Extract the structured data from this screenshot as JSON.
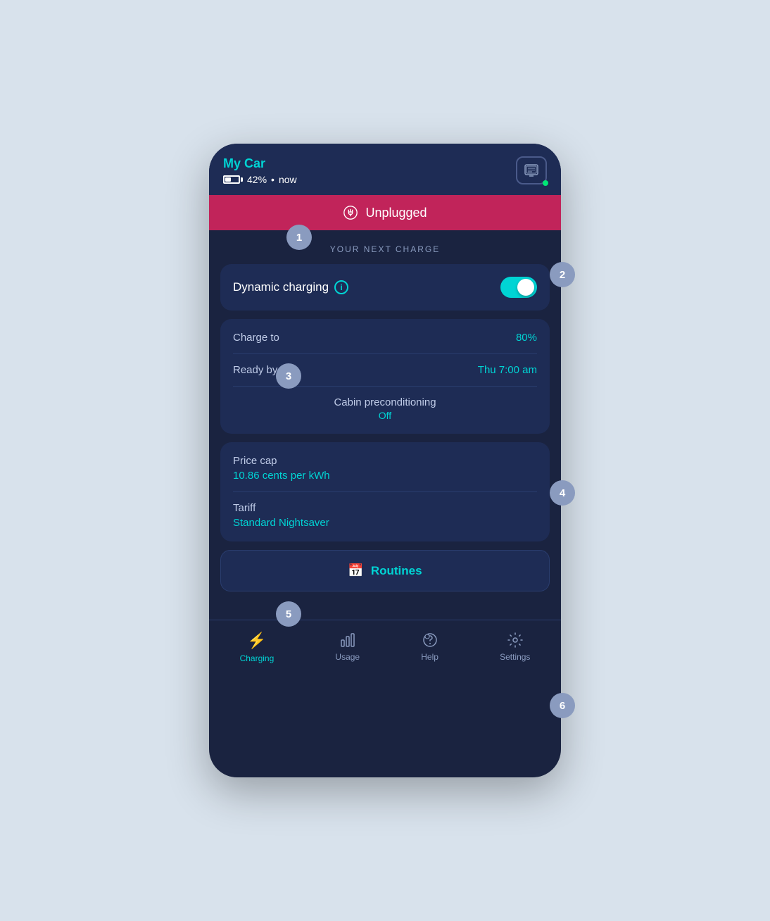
{
  "header": {
    "car_name": "My Car",
    "battery_percent": "42%",
    "battery_time": "now",
    "device_icon": "device-icon"
  },
  "status": {
    "label": "Unplugged",
    "state": "unplugged"
  },
  "next_charge": {
    "section_title": "YOUR NEXT CHARGE",
    "dynamic_charging": {
      "label": "Dynamic charging",
      "info": "i",
      "enabled": true
    },
    "charge_to": {
      "label": "Charge to",
      "value": "80%"
    },
    "ready_by": {
      "label": "Ready by",
      "value": "Thu 7:00 am"
    },
    "cabin_preconditioning": {
      "label": "Cabin preconditioning",
      "value": "Off"
    }
  },
  "pricing": {
    "price_cap": {
      "label": "Price cap",
      "value": "10.86 cents per kWh"
    },
    "tariff": {
      "label": "Tariff",
      "value": "Standard Nightsaver"
    }
  },
  "routines": {
    "label": "Routines"
  },
  "bottom_nav": {
    "items": [
      {
        "id": "charging",
        "label": "Charging",
        "active": true
      },
      {
        "id": "usage",
        "label": "Usage",
        "active": false
      },
      {
        "id": "help",
        "label": "Help",
        "active": false
      },
      {
        "id": "settings",
        "label": "Settings",
        "active": false
      }
    ]
  },
  "annotations": [
    {
      "number": "1"
    },
    {
      "number": "2"
    },
    {
      "number": "3"
    },
    {
      "number": "4"
    },
    {
      "number": "5"
    },
    {
      "number": "6"
    }
  ]
}
